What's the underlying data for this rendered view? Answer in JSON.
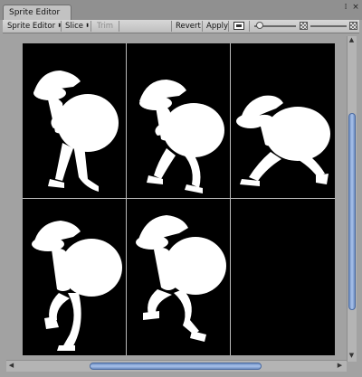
{
  "window": {
    "tab_title": "Sprite Editor",
    "controls": [
      "options-icon",
      "close-icon"
    ]
  },
  "toolbar": {
    "mode_label": "Sprite Editor",
    "slice_label": "Slice",
    "trim_label": "Trim",
    "revert_label": "Revert",
    "apply_label": "Apply",
    "dropdown_arrow": "⬍"
  },
  "canvas": {
    "background": "#000000",
    "grid_color": "#b9b9b9",
    "grid": {
      "columns": 3,
      "rows": 2
    },
    "sprites": [
      {
        "frame": 1,
        "pose": "walk-upright"
      },
      {
        "frame": 2,
        "pose": "walk-crouch"
      },
      {
        "frame": 3,
        "pose": "run-lean"
      },
      {
        "frame": 4,
        "pose": "hop-knee-up"
      },
      {
        "frame": 5,
        "pose": "step-crouch"
      },
      {
        "frame": 6,
        "pose": "empty"
      }
    ]
  },
  "colors": {
    "window_bg": "#a2a2a2",
    "toolbar_bg": "#cbcbcb",
    "scroll_thumb": "#8fa9d8"
  }
}
